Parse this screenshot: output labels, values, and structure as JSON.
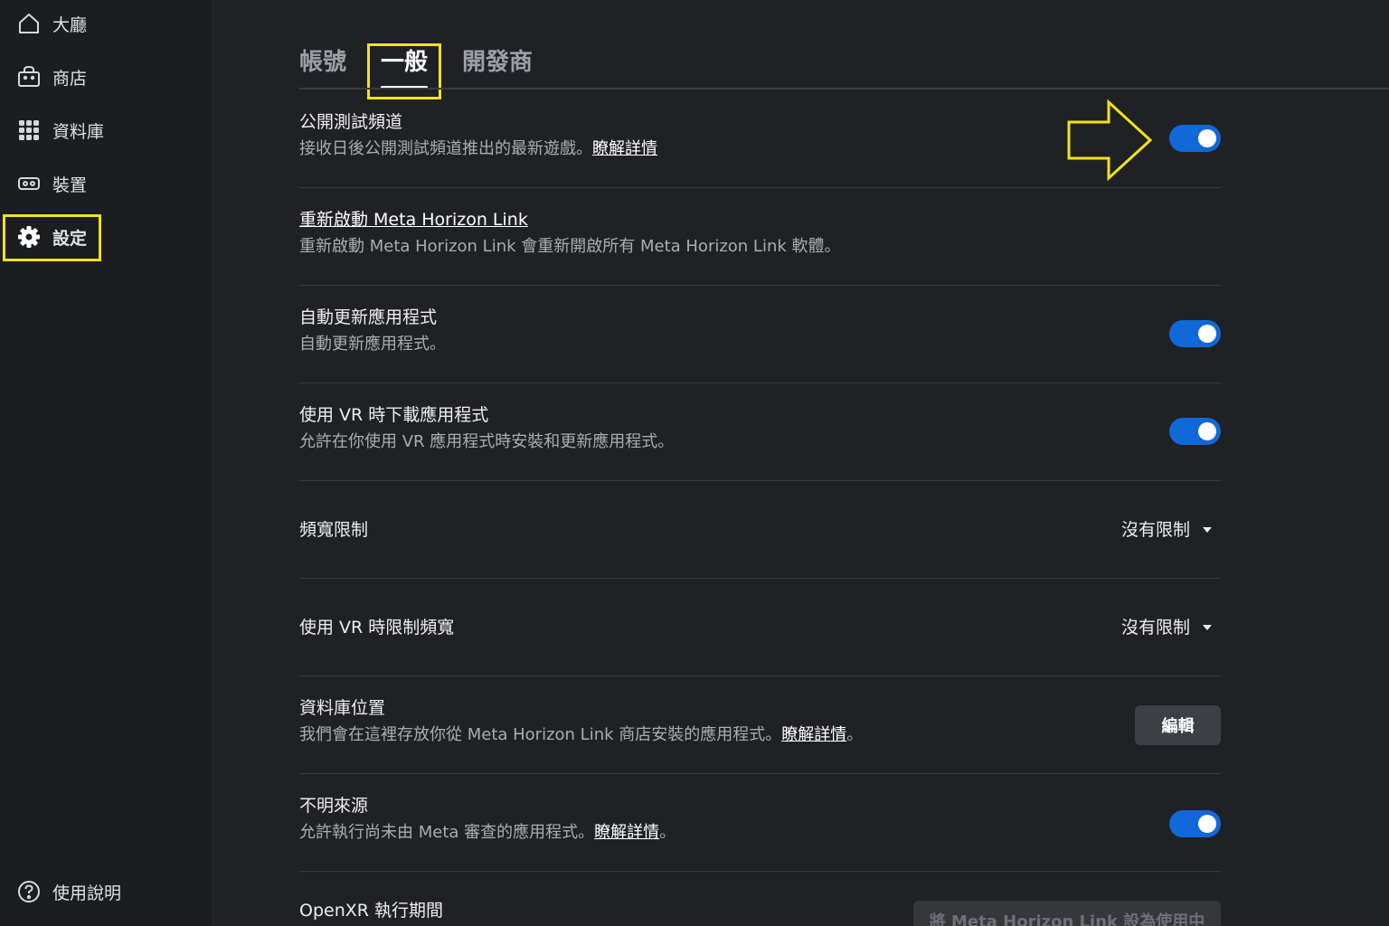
{
  "sidebar": {
    "items": [
      {
        "label": "大廳",
        "icon": "home-icon"
      },
      {
        "label": "商店",
        "icon": "store-icon"
      },
      {
        "label": "資料庫",
        "icon": "grid-icon"
      },
      {
        "label": "裝置",
        "icon": "headset-icon"
      },
      {
        "label": "設定",
        "icon": "gear-icon",
        "active": true
      }
    ],
    "help": {
      "label": "使用說明",
      "icon": "help-icon"
    }
  },
  "tabs": [
    {
      "label": "帳號"
    },
    {
      "label": "一般",
      "active": true
    },
    {
      "label": "開發商"
    }
  ],
  "settings": {
    "public_test": {
      "title": "公開測試頻道",
      "desc": "接收日後公開測試頻道推出的最新遊戲。",
      "link": "瞭解詳情",
      "enabled": true
    },
    "restart": {
      "title": "重新啟動 Meta Horizon Link",
      "desc": "重新啟動 Meta Horizon Link 會重新開啟所有 Meta Horizon Link 軟體。"
    },
    "auto_update": {
      "title": "自動更新應用程式",
      "desc": "自動更新應用程式。",
      "enabled": true
    },
    "vr_download": {
      "title": "使用 VR 時下載應用程式",
      "desc": "允許在你使用 VR 應用程式時安裝和更新應用程式。",
      "enabled": true
    },
    "bandwidth": {
      "title": "頻寬限制",
      "value": "沒有限制"
    },
    "vr_bandwidth": {
      "title": "使用 VR 時限制頻寬",
      "value": "沒有限制"
    },
    "library_location": {
      "title": "資料庫位置",
      "desc": "我們會在這裡存放你從 Meta Horizon Link 商店安裝的應用程式。",
      "link": "瞭解詳情",
      "suffix": "。",
      "button": "編輯"
    },
    "unknown_sources": {
      "title": "不明來源",
      "desc": "允許執行尚未由 Meta 審查的應用程式。",
      "link": "瞭解詳情",
      "suffix": "。",
      "enabled": true
    },
    "openxr": {
      "title": "OpenXR 執行期間",
      "button": "將 Meta Horizon Link 設為使用中"
    }
  },
  "colors": {
    "accent": "#1168d8",
    "highlight": "#f2e21b",
    "background": "#202124"
  }
}
